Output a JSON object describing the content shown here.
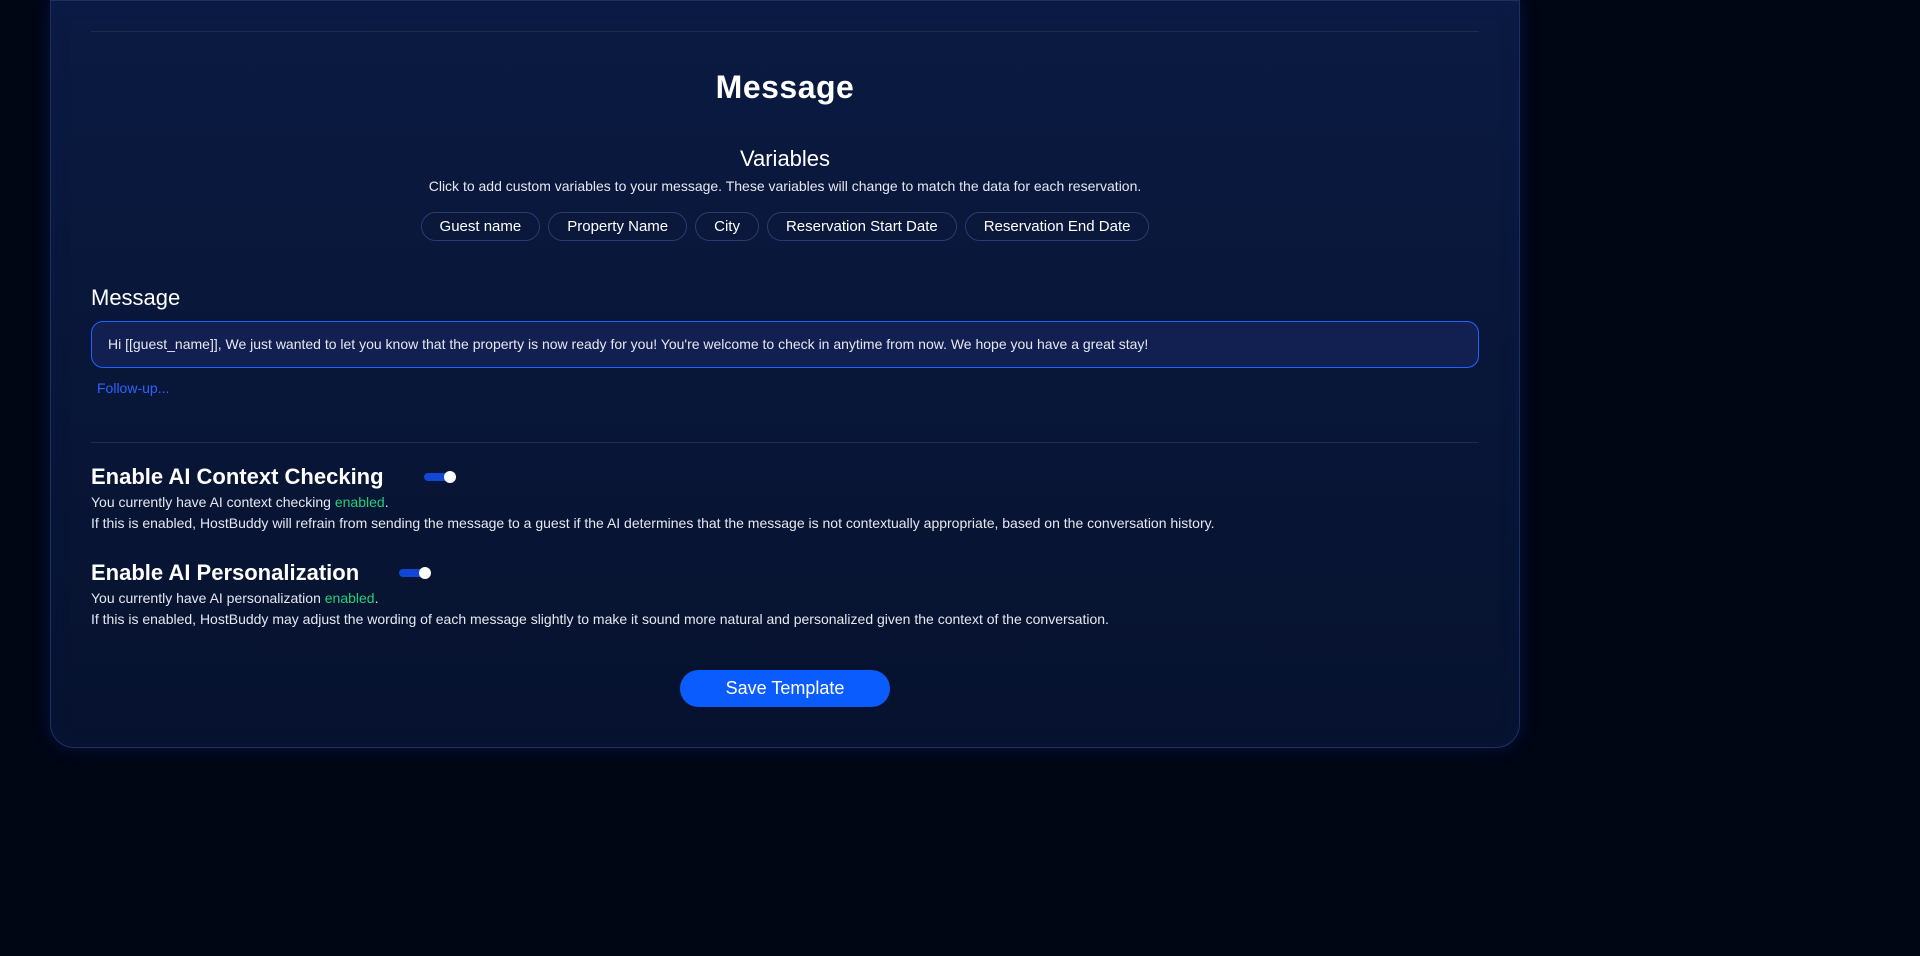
{
  "section_title": "Message",
  "variables": {
    "heading": "Variables",
    "description": "Click to add custom variables to your message. These variables will change to match the data for each reservation.",
    "chips": [
      "Guest name",
      "Property Name",
      "City",
      "Reservation Start Date",
      "Reservation End Date"
    ]
  },
  "message": {
    "label": "Message",
    "value": "Hi [[guest_name]], We just wanted to let you know that the property is now ready for you! You're welcome to check in anytime from now. We hope you have a great stay!"
  },
  "followup": "Follow-up...",
  "context_checking": {
    "title": "Enable AI Context Checking",
    "line1_prefix": "You currently have AI context checking ",
    "status": "enabled",
    "line1_suffix": ".",
    "line2": "If this is enabled, HostBuddy will refrain from sending the message to a guest if the AI determines that the message is not contextually appropriate, based on the conversation history."
  },
  "personalization": {
    "title": "Enable AI Personalization",
    "line1_prefix": "You currently have AI personalization ",
    "status": "enabled",
    "line1_suffix": ".",
    "line2": "If this is enabled, HostBuddy may adjust the wording of each message slightly to make it sound more natural and personalized given the context of the conversation."
  },
  "save_label": "Save Template"
}
